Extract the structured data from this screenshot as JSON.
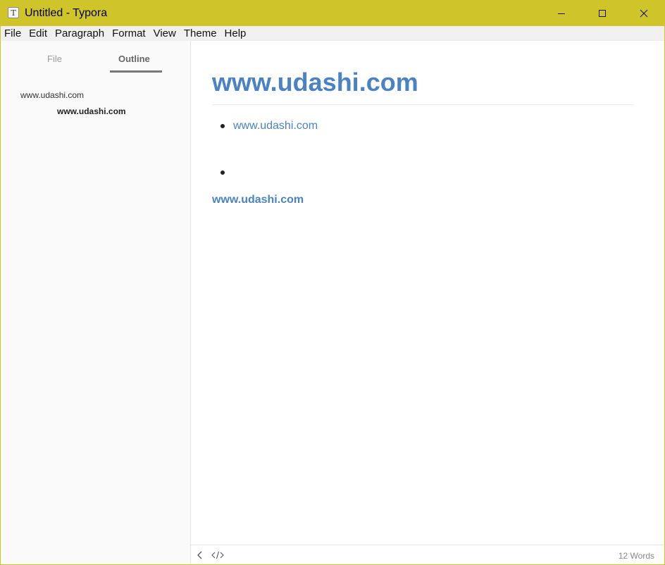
{
  "titlebar": {
    "app_icon_letter": "T",
    "title": "Untitled - Typora"
  },
  "menu": [
    "File",
    "Edit",
    "Paragraph",
    "Format",
    "View",
    "Theme",
    "Help"
  ],
  "sidebar": {
    "tabs": [
      {
        "label": "File",
        "active": false
      },
      {
        "label": "Outline",
        "active": true
      }
    ],
    "outline": [
      {
        "label": "www.udashi.com",
        "level": 1
      },
      {
        "label": "www.udashi.com",
        "level": 2
      }
    ]
  },
  "document": {
    "heading": "www.udashi.com",
    "list_items": [
      "www.udashi.com",
      ""
    ],
    "bold_link": "www.udashi.com"
  },
  "statusbar": {
    "word_count": "12 Words"
  },
  "colors": {
    "titlebar_accent": "#cfc52a",
    "link": "#4a82c4"
  }
}
